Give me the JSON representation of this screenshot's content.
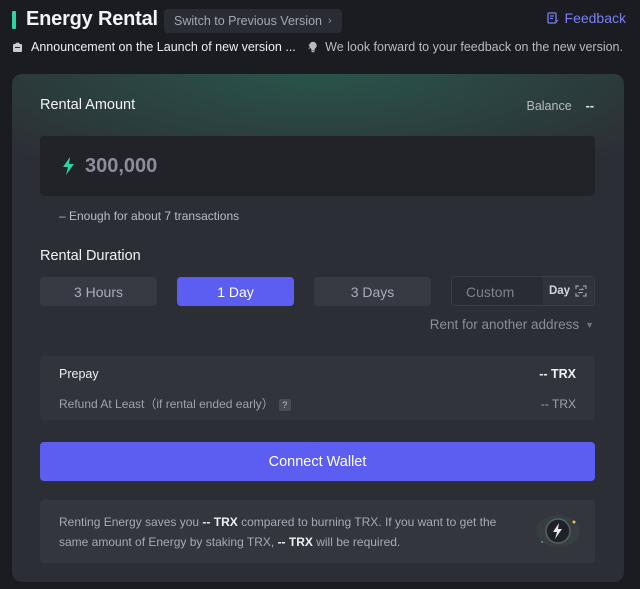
{
  "header": {
    "title": "Energy Rental",
    "switch_label": "Switch to Previous Version",
    "feedback_label": "Feedback"
  },
  "announcement": {
    "left_text": "Announcement on the Launch of new version ...",
    "right_text": "We look forward to your feedback on the new version."
  },
  "rental": {
    "amount_label": "Rental Amount",
    "balance_label": "Balance",
    "balance_value": "--",
    "amount_value": "300,000",
    "enough_text": "– Enough for about 7 transactions"
  },
  "duration": {
    "label": "Rental Duration",
    "options": [
      "3 Hours",
      "1 Day",
      "3 Days"
    ],
    "selected": "1 Day",
    "custom_placeholder": "Custom",
    "custom_unit": "Day"
  },
  "rent_other_label": "Rent for another address",
  "summary": {
    "prepay_label": "Prepay",
    "prepay_value": "-- TRX",
    "refund_label": "Refund At Least（if rental ended early）",
    "refund_value": "-- TRX"
  },
  "connect_label": "Connect Wallet",
  "info": {
    "part1": "Renting Energy saves you ",
    "bold1": "-- TRX",
    "part2": " compared to burning TRX. If you want to get the same amount of Energy by staking TRX, ",
    "bold2": "-- TRX",
    "part3": " will be required."
  },
  "colors": {
    "accent": "#5b5ef0",
    "brand_green": "#2fd4a5",
    "feedback": "#7b7ff6",
    "background": "#1b1c22",
    "card": "#2c2e35"
  },
  "icons": [
    "clipboard-icon",
    "lightbulb-icon",
    "edit-icon",
    "bolt-icon",
    "swap-icon",
    "energy-coin-icon"
  ]
}
